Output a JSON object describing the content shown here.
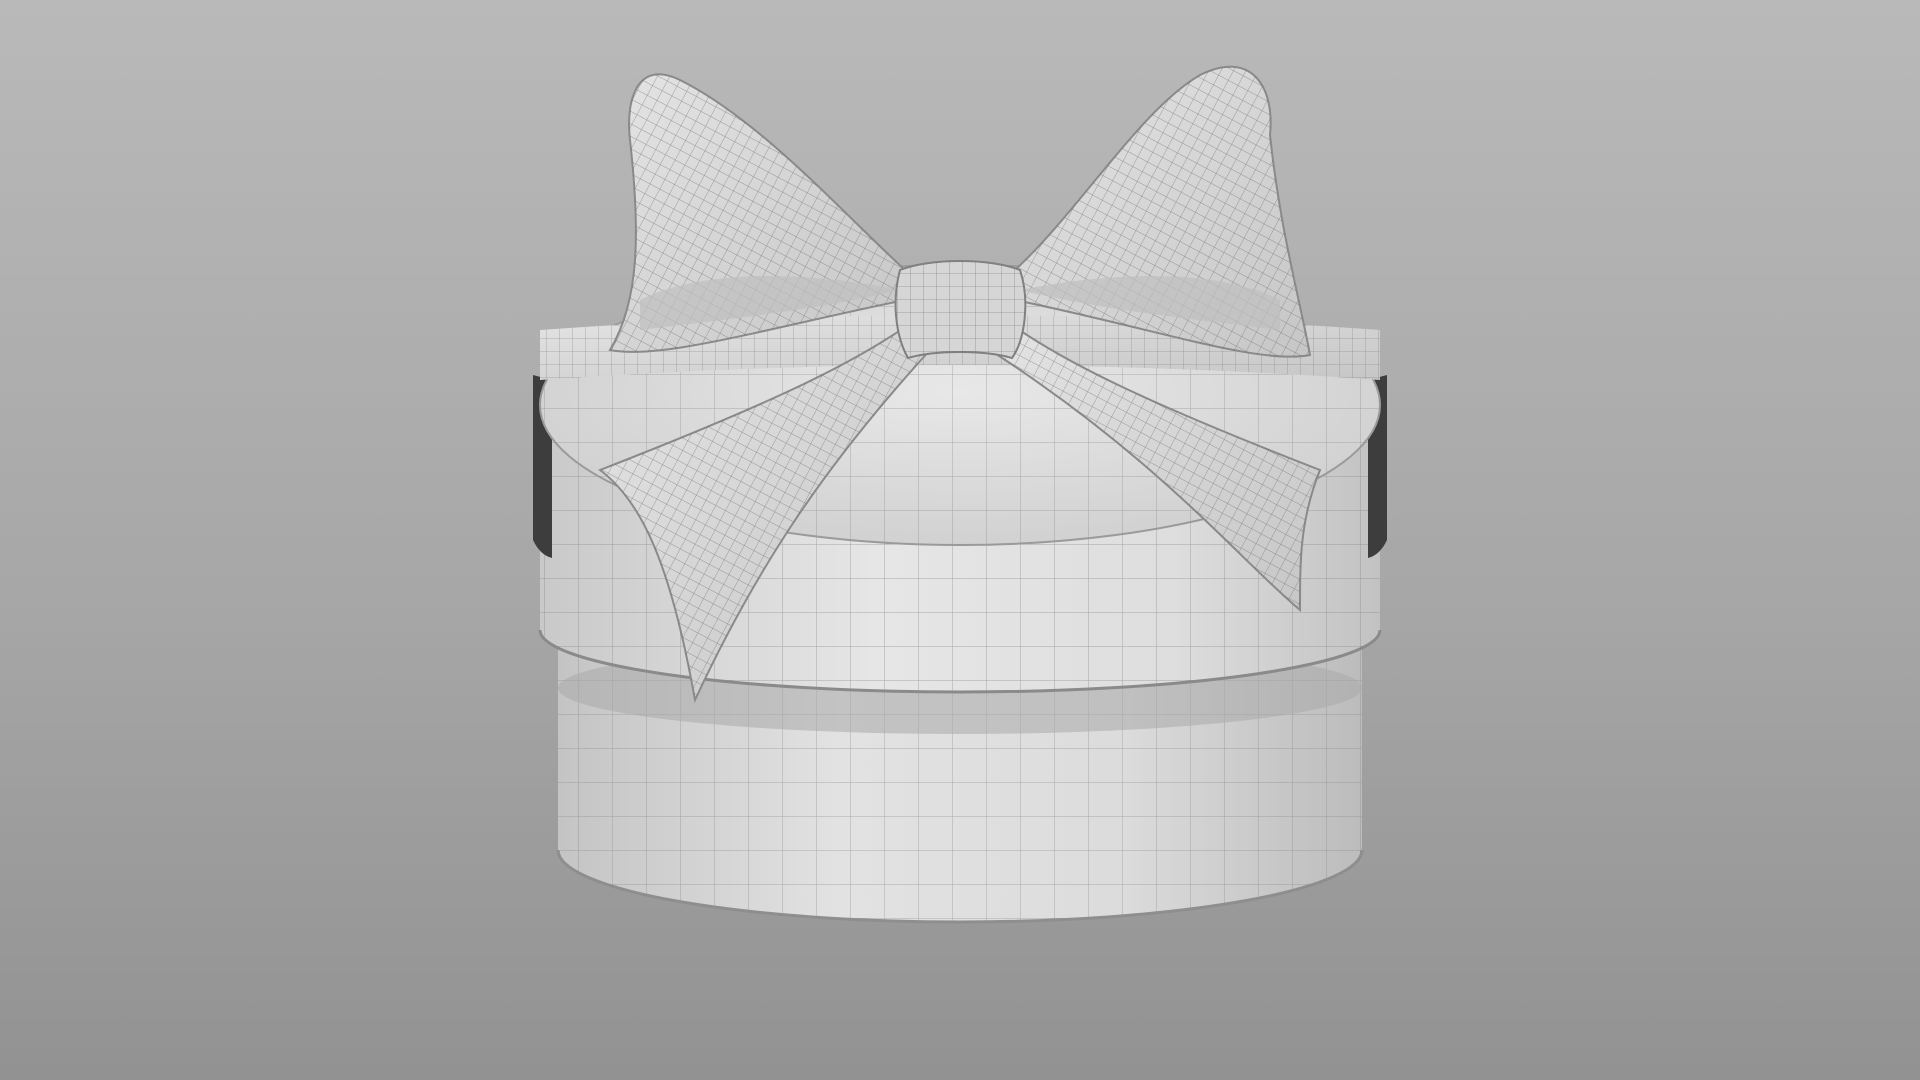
{
  "scene": {
    "subject": "wireframe-gift-box",
    "colors": {
      "background_top": "#b9b9b9",
      "background_bottom": "#929292",
      "surface": "#d9d9d9",
      "surface_light": "#e6e6e6",
      "surface_shade": "#bdbdbd",
      "wire": "#7a7a7a",
      "ribbon_dark": "#3a3a3a"
    }
  }
}
